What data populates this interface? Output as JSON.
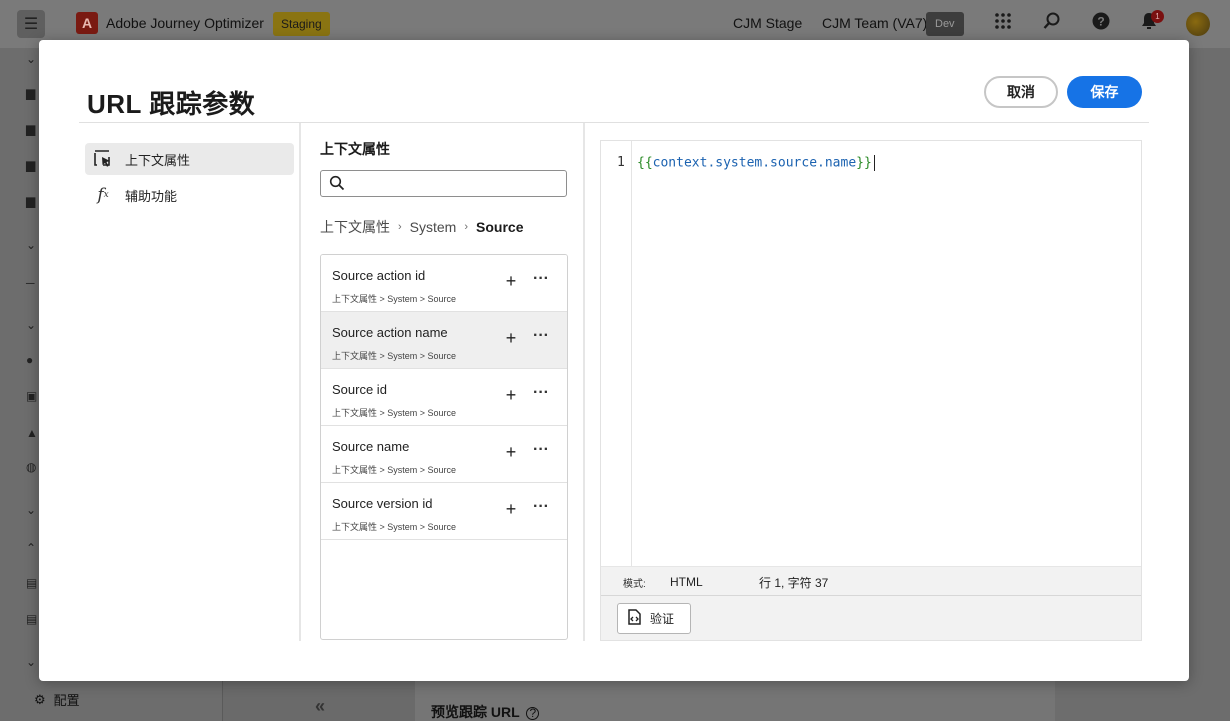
{
  "app": {
    "name": "Adobe Journey Optimizer",
    "environment": "Staging",
    "sandbox": "CJM Stage",
    "org": "CJM Team (VA7)",
    "org_badge": "Dev",
    "notification_count": "1",
    "settings_label": "配置",
    "preview_label": "预览跟踪 URL"
  },
  "modal": {
    "title": "URL 跟踪参数",
    "cancel_label": "取消",
    "save_label": "保存"
  },
  "nav": {
    "items": [
      {
        "label": "上下文属性",
        "icon": "cursor-select-icon",
        "selected": true
      },
      {
        "label": "辅助功能",
        "icon": "function-icon",
        "selected": false
      }
    ]
  },
  "browser": {
    "title": "上下文属性",
    "search_placeholder": "",
    "search_value": "",
    "breadcrumb": [
      "上下文属性",
      "System",
      "Source"
    ],
    "items": [
      {
        "name": "Source action id",
        "path": "上下文属性 > System > Source"
      },
      {
        "name": "Source action name",
        "path": "上下文属性 > System > Source"
      },
      {
        "name": "Source id",
        "path": "上下文属性 > System > Source"
      },
      {
        "name": "Source name",
        "path": "上下文属性 > System > Source"
      },
      {
        "name": "Source version id",
        "path": "上下文属性 > System > Source"
      }
    ]
  },
  "editor": {
    "line_number": "1",
    "open_braces": "{{",
    "expression": "context.system.source.name",
    "close_braces": "}}",
    "mode_label": "模式:",
    "mode_value": "HTML",
    "cursor_position": "行 1, 字符 37",
    "validate_label": "验证"
  },
  "colors": {
    "accent": "#1673e6",
    "brace": "#2a8a26",
    "expression": "#1b62b0"
  }
}
